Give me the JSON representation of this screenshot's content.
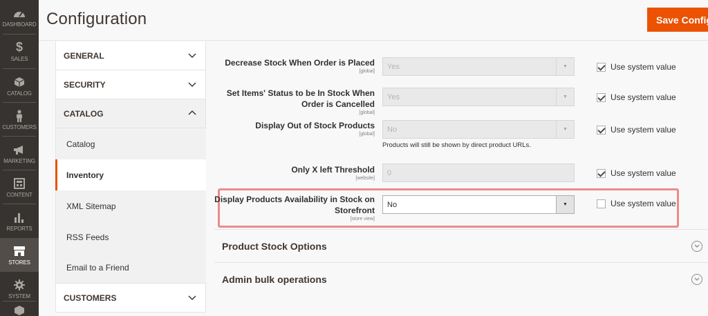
{
  "nav": [
    {
      "label": "DASHBOARD",
      "icon": "dashboard-icon"
    },
    {
      "label": "SALES",
      "icon": "dollar-icon"
    },
    {
      "label": "CATALOG",
      "icon": "cube-icon"
    },
    {
      "label": "CUSTOMERS",
      "icon": "person-icon"
    },
    {
      "label": "MARKETING",
      "icon": "megaphone-icon"
    },
    {
      "label": "CONTENT",
      "icon": "layout-icon"
    },
    {
      "label": "REPORTS",
      "icon": "bar-chart-icon"
    },
    {
      "label": "STORES",
      "icon": "store-icon"
    },
    {
      "label": "SYSTEM",
      "icon": "gear-icon"
    }
  ],
  "header": {
    "title": "Configuration",
    "save_label": "Save Config"
  },
  "tabs": {
    "general": "GENERAL",
    "security": "SECURITY",
    "catalog": "CATALOG",
    "catalog_items": [
      "Catalog",
      "Inventory",
      "XML Sitemap",
      "RSS Feeds",
      "Email to a Friend"
    ],
    "customers": "CUSTOMERS"
  },
  "fields": {
    "decrease_stock": {
      "label": "Decrease Stock When Order is Placed",
      "scope": "[global]",
      "value": "Yes",
      "use_system": "Use system value"
    },
    "set_items_status": {
      "label": "Set Items' Status to be In Stock When Order is Cancelled",
      "scope": "[global]",
      "value": "Yes",
      "use_system": "Use system value"
    },
    "display_out_of_stock": {
      "label": "Display Out of Stock Products",
      "scope": "[global]",
      "value": "No",
      "note": "Products will still be shown by direct product URLs.",
      "use_system": "Use system value"
    },
    "only_x_left": {
      "label": "Only X left Threshold",
      "scope": "[website]",
      "value": "0",
      "use_system": "Use system value"
    },
    "display_availability": {
      "label": "Display Products Availability in Stock on Storefront",
      "scope": "[store view]",
      "value": "No",
      "use_system": "Use system value"
    }
  },
  "sections": {
    "product_stock_options": "Product Stock Options",
    "admin_bulk": "Admin bulk operations"
  },
  "colors": {
    "accent": "#eb5202",
    "nav_bg": "#373330",
    "highlight": "#ee8a8a"
  }
}
